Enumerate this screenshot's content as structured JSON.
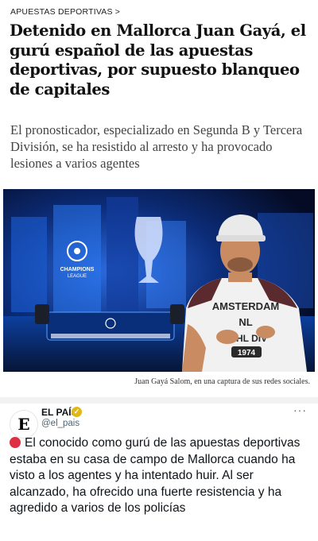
{
  "article": {
    "section": "APUESTAS DEPORTIVAS >",
    "headline": "Detenido en Mallorca Juan Gayá, el gurú español de las apuestas deportivas, por supuesto blanqueo de capitales",
    "subtitle": "El pronosticador, especializado en Segunda B y Tercera División, se ha resistido al arresto y ha provocado lesiones a varios agentes",
    "photo": {
      "caption": "Juan Gayá Salom, en una captura de sus redes sociales.",
      "shirt_text": "AMSTERDAM NL ATHL DIV 1974",
      "brand_text": "CHAMPIONS LEAGUE"
    }
  },
  "tweet": {
    "avatar_letter": "E",
    "author": "EL PAÍS",
    "handle": "@el_pais",
    "more_label": "···",
    "text": "El conocido como gurú de las apuestas deportivas estaba en su casa de campo de Mallorca cuando ha visto a los agentes y ha intentado huir. Al ser alcanzado, ha ofrecido una fuerte resistencia y ha agredido a varios de los policías",
    "icons": [
      "red-circle-icon",
      "verified-badge-icon",
      "more-options-icon"
    ]
  },
  "colors": {
    "verified": "#e2b719",
    "red_circle": "#dd2e44",
    "handle": "#536471",
    "studio_blue": "#0b3a9a"
  }
}
